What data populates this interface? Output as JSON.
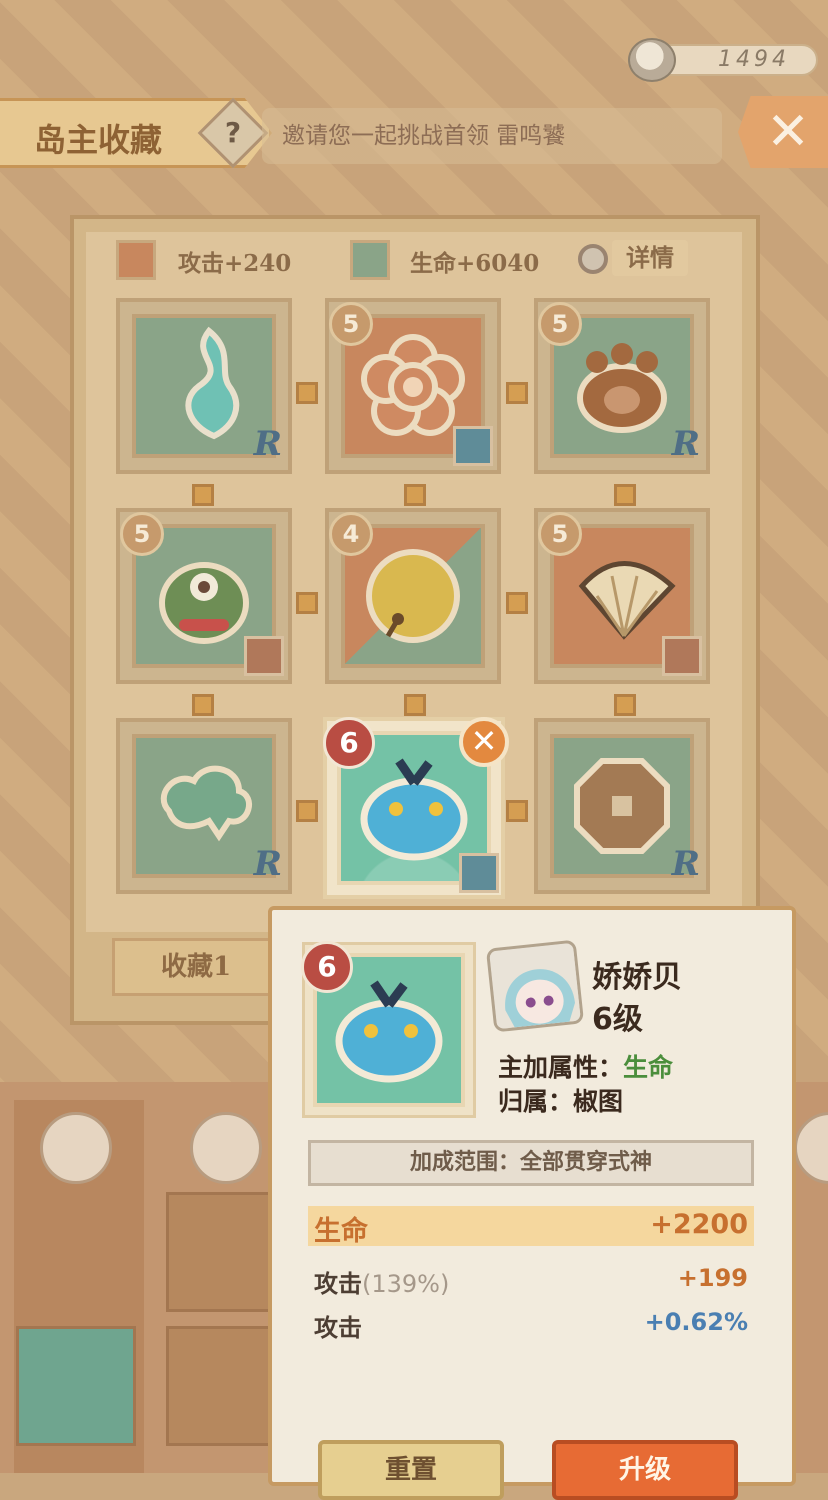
{
  "header": {
    "currency_value": "1494",
    "title": "岛主收藏",
    "help_symbol": "?",
    "invite_name": "雷鸣饕",
    "invite_text": "邀请您一起挑战首领 雷鸣饕",
    "close_symbol": "✕"
  },
  "board": {
    "attack_label": "攻击+240",
    "hp_label": "生命+6040",
    "detail_label": "详情",
    "colors": {
      "attack": "#c8875e",
      "hp": "#8aa488"
    },
    "slots": [
      {
        "level": "",
        "badge": "R",
        "icon": "blue-flame-icon"
      },
      {
        "level": "5",
        "badge": "",
        "icon": "flower-icon"
      },
      {
        "level": "5",
        "badge": "",
        "icon": "paw-icon"
      },
      {
        "level": "5",
        "badge": "",
        "icon": "monster-icon"
      },
      {
        "level": "4",
        "badge": "",
        "icon": "bell-icon"
      },
      {
        "level": "5",
        "badge": "",
        "icon": "fan-icon"
      },
      {
        "level": "",
        "badge": "R",
        "icon": "cloud-tree-icon"
      },
      {
        "level": "6",
        "badge": "",
        "icon": "blue-slime-icon"
      },
      {
        "level": "",
        "badge": "R",
        "icon": "coin-icon"
      }
    ],
    "selected_close": "✕",
    "collection_tab": "收藏1"
  },
  "popup": {
    "level": "6",
    "name": "娇娇贝",
    "level_text": "6级",
    "main_attr_key": "主加属性：",
    "main_attr_value": "生命",
    "owner_key": "归属：",
    "owner_value": "椒图",
    "range": "加成范围：全部贯穿式神",
    "rows": [
      {
        "key": "生命",
        "pct": "",
        "value": "+2200",
        "color": "#c7702f"
      },
      {
        "key": "攻击",
        "pct": "(139%)",
        "value": "+199",
        "color": "#c7702f"
      },
      {
        "key": "攻击",
        "pct": "",
        "value": "+0.62%",
        "color": "#4a7fb2"
      }
    ],
    "reset_label": "重置",
    "upgrade_label": "升级"
  }
}
